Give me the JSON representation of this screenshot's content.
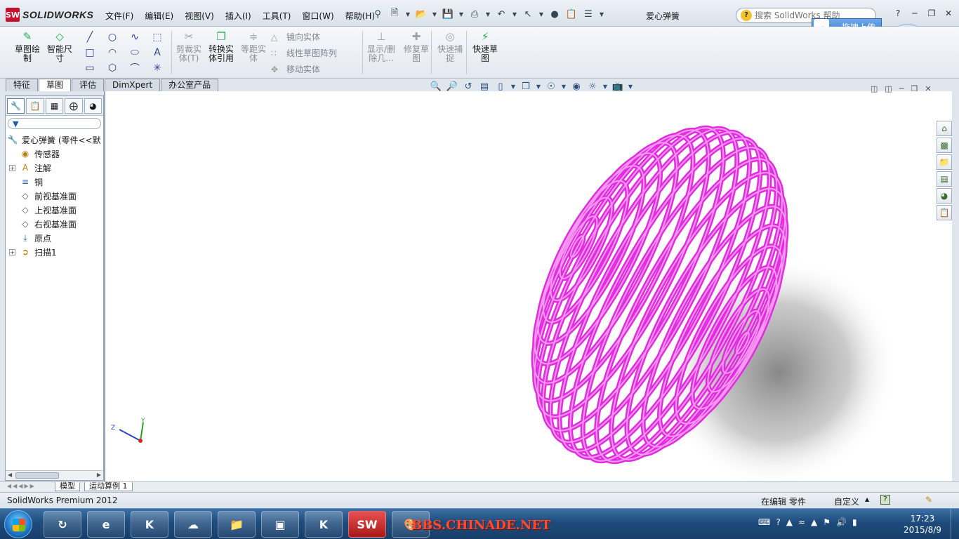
{
  "app": {
    "brand": "SOLIDWORKS",
    "logo_text": "SW",
    "document_title": "爱心弹簧",
    "help_search_placeholder": "搜索 SolidWorks 帮助",
    "upload_label": "拖拽上传"
  },
  "menu": [
    "文件(F)",
    "编辑(E)",
    "视图(V)",
    "插入(I)",
    "工具(T)",
    "窗口(W)",
    "帮助(H)"
  ],
  "command_manager": {
    "big_buttons": [
      {
        "label": "草图绘制",
        "icon": "sketch-icon"
      },
      {
        "label": "智能尺寸",
        "icon": "smart-dimension-icon"
      },
      {
        "label": "剪裁实体(T)",
        "icon": "trim-icon"
      },
      {
        "label": "转换实体引用",
        "icon": "convert-entities-icon"
      },
      {
        "label": "等距实体",
        "icon": "offset-entities-icon"
      },
      {
        "label": "显示/删除几...",
        "icon": "display-delete-relations-icon"
      },
      {
        "label": "修复草图",
        "icon": "repair-sketch-icon"
      },
      {
        "label": "快速捕捉",
        "icon": "quick-snaps-icon"
      },
      {
        "label": "快速草图",
        "icon": "rapid-sketch-icon"
      }
    ],
    "row_items": [
      {
        "label": "镜向实体",
        "icon": "mirror-icon"
      },
      {
        "label": "线性草图阵列",
        "icon": "linear-pattern-icon"
      },
      {
        "label": "移动实体",
        "icon": "move-entities-icon"
      }
    ]
  },
  "command_tabs": [
    {
      "label": "特征",
      "active": false
    },
    {
      "label": "草图",
      "active": true
    },
    {
      "label": "评估",
      "active": false
    },
    {
      "label": "DimXpert",
      "active": false
    },
    {
      "label": "办公室产品",
      "active": false
    }
  ],
  "feature_tree": {
    "root": "爱心弹簧 (零件<<默",
    "items": [
      {
        "label": "传感器",
        "icon": "sensor-icon",
        "expandable": false
      },
      {
        "label": "注解",
        "icon": "annotation-icon",
        "expandable": true
      },
      {
        "label": "铜",
        "icon": "material-icon",
        "expandable": false
      },
      {
        "label": "前视基准面",
        "icon": "plane-icon",
        "expandable": false
      },
      {
        "label": "上视基准面",
        "icon": "plane-icon",
        "expandable": false
      },
      {
        "label": "右视基准面",
        "icon": "plane-icon",
        "expandable": false
      },
      {
        "label": "原点",
        "icon": "origin-icon",
        "expandable": false
      },
      {
        "label": "扫描1",
        "icon": "sweep-icon",
        "expandable": true
      }
    ]
  },
  "triad": {
    "x": "",
    "y": "Y",
    "z": "Z"
  },
  "bottom_tabs": [
    "模型",
    "运动算例 1"
  ],
  "status": {
    "left": "SolidWorks Premium 2012",
    "editing": "在编辑 零件",
    "units": "自定义"
  },
  "taskbar": {
    "time": "17:23",
    "date": "2015/8/9",
    "watermark": "BBS.CHINADE.NET"
  },
  "colors": {
    "model": "#e22ce0",
    "model_shadow": "#9a9a9a"
  }
}
